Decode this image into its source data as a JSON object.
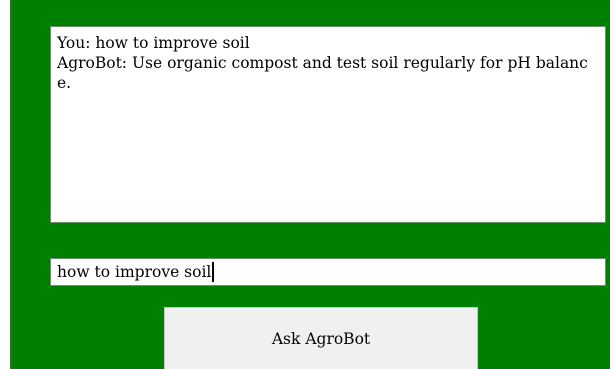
{
  "chat": {
    "lines": [
      "You: how to improve soil",
      "AgroBot: Use organic compost and test soil regularly for pH balance."
    ]
  },
  "input": {
    "value": "how to improve soil"
  },
  "ask_button": {
    "label": "Ask AgroBot"
  },
  "colors": {
    "window_background": "#008000",
    "text_area_background": "#ffffff",
    "button_background": "#f0f0f0"
  }
}
